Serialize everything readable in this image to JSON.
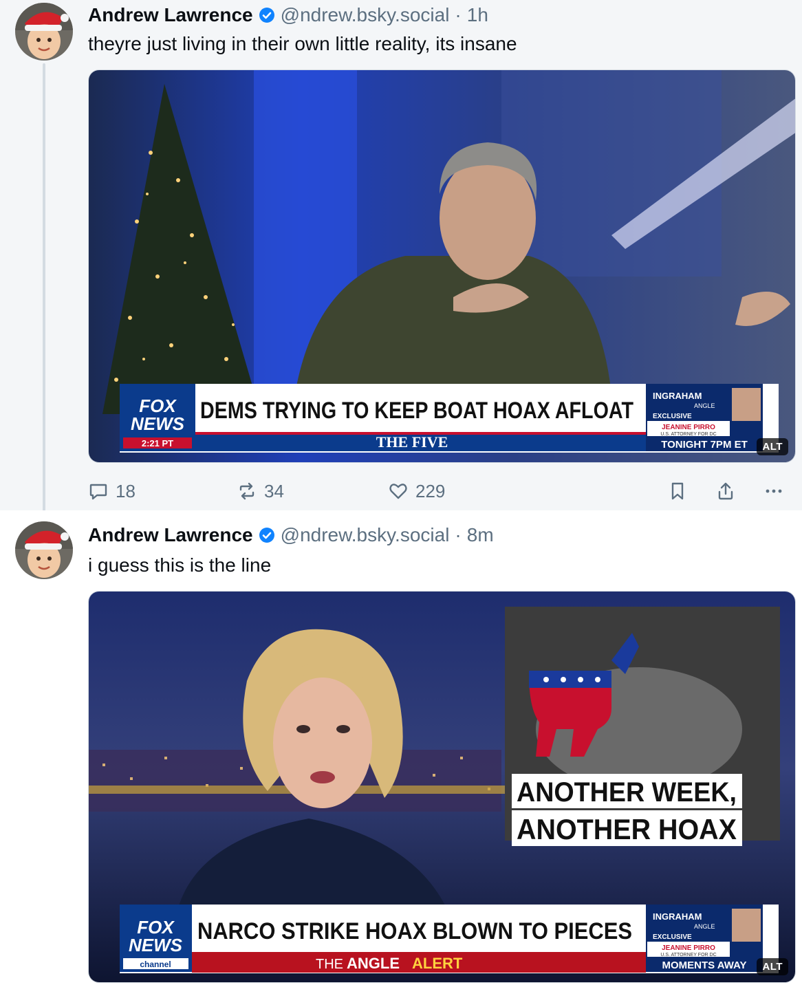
{
  "posts": [
    {
      "author": "Andrew Lawrence",
      "handle": "@ndrew.bsky.social",
      "separator": "·",
      "age": "1h",
      "text": "theyre just living in their own little reality, its insane",
      "image": {
        "headline": "DEMS TRYING TO KEEP BOAT HOAX AFLOAT",
        "show": "THE FIVE",
        "show_prefix": "THE",
        "show_name": "FIVE",
        "logo_line1": "FOX",
        "logo_line2": "NEWS",
        "logo_time": "2:21 PT",
        "promo_title": "INGRAHAM",
        "promo_sub": "ANGLE",
        "promo_exclusive": "EXCLUSIVE",
        "promo_guest": "JEANINE PIRRO",
        "promo_guest_title": "U.S. ATTORNEY FOR DC",
        "promo_time": "TONIGHT 7PM ET",
        "alt_label": "ALT"
      },
      "actions": {
        "replies": "18",
        "reposts": "34",
        "likes": "229"
      }
    },
    {
      "author": "Andrew Lawrence",
      "handle": "@ndrew.bsky.social",
      "separator": "·",
      "age": "8m",
      "text": "i guess this is the line",
      "image": {
        "headline": "NARCO STRIKE HOAX BLOWN TO PIECES",
        "show_prefix": "THE",
        "show_name": "ANGLE",
        "show_suffix": "ALERT",
        "logo_line1": "FOX",
        "logo_line2": "NEWS",
        "logo_time": "channel",
        "graphic_line1": "ANOTHER WEEK,",
        "graphic_line2": "ANOTHER HOAX",
        "promo_title": "INGRAHAM",
        "promo_sub": "ANGLE",
        "promo_exclusive": "EXCLUSIVE",
        "promo_guest": "JEANINE PIRRO",
        "promo_guest_title": "U.S. ATTORNEY FOR DC",
        "promo_time": "MOMENTS AWAY",
        "alt_label": "ALT"
      }
    }
  ],
  "colors": {
    "verified": "#1083fe",
    "muted": "#5c6f80",
    "thread_line": "#d4dbe2",
    "fox_blue": "#0b3b8c",
    "fox_red": "#c8102e"
  },
  "icons": [
    "reply-icon",
    "repost-icon",
    "like-icon",
    "bookmark-icon",
    "share-icon",
    "more-icon",
    "verified-icon"
  ]
}
